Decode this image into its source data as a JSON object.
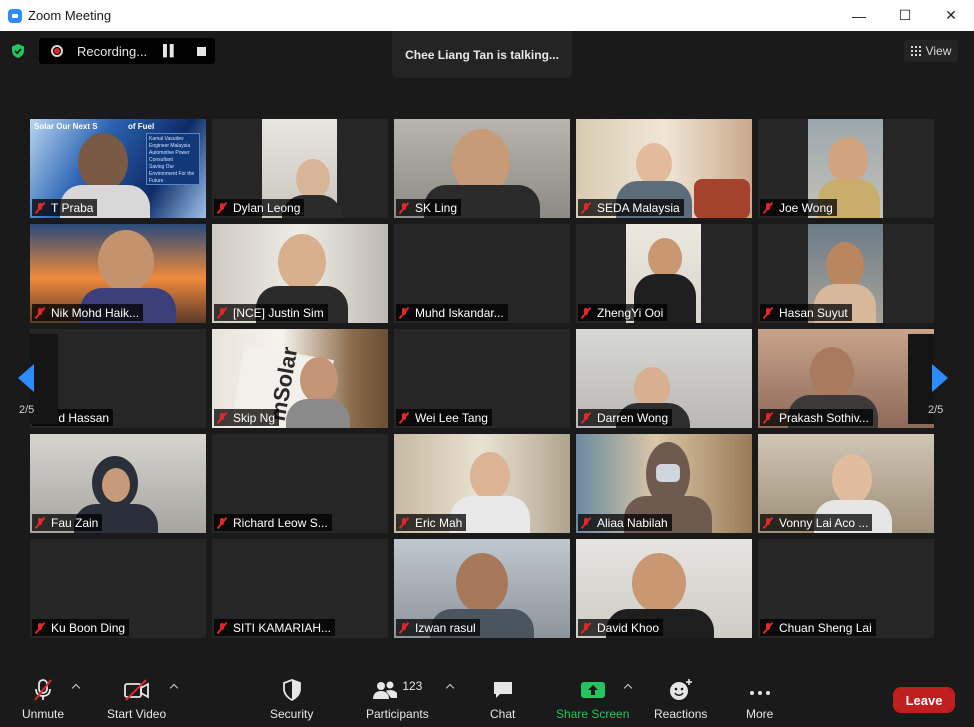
{
  "window": {
    "title": "Zoom Meeting"
  },
  "window_controls": [
    "—",
    "☐",
    "✕"
  ],
  "recording": {
    "label": "Recording...",
    "status": "recording"
  },
  "speaker_banner": "Chee Liang Tan is talking...",
  "view_button": "View",
  "gallery": {
    "page_indicator": "2/5",
    "participants": [
      {
        "name": "T Praba",
        "muted": true,
        "video": true
      },
      {
        "name": "Dylan Leong",
        "muted": true,
        "video": true
      },
      {
        "name": "SK Ling",
        "muted": true,
        "video": true
      },
      {
        "name": "SEDA Malaysia",
        "muted": true,
        "video": true
      },
      {
        "name": "Joe Wong",
        "muted": true,
        "video": true
      },
      {
        "name": "Nik Mohd Haik...",
        "muted": true,
        "video": true
      },
      {
        "name": "[NCE] Justin Sim",
        "muted": true,
        "video": true
      },
      {
        "name": "Muhd Iskandar...",
        "muted": true,
        "video": false
      },
      {
        "name": "ZhengYi Ooi",
        "muted": true,
        "video": true
      },
      {
        "name": "Hasan Suyut",
        "muted": true,
        "video": true
      },
      {
        "name": "Mohd Hassan",
        "muted": false,
        "video": false
      },
      {
        "name": "Skip Ng",
        "muted": true,
        "video": true
      },
      {
        "name": "Wei Lee Tang",
        "muted": true,
        "video": false
      },
      {
        "name": "Darren Wong",
        "muted": true,
        "video": true
      },
      {
        "name": "Prakash Sothiv...",
        "muted": true,
        "video": true
      },
      {
        "name": "Fau Zain",
        "muted": true,
        "video": true
      },
      {
        "name": "Richard Leow S...",
        "muted": true,
        "video": false
      },
      {
        "name": "Eric Mah",
        "muted": true,
        "video": true
      },
      {
        "name": "Aliaa Nabilah",
        "muted": true,
        "video": true
      },
      {
        "name": "Vonny Lai Aco ...",
        "muted": true,
        "video": true
      },
      {
        "name": "Ku Boon Ding",
        "muted": true,
        "video": false
      },
      {
        "name": "SITI KAMARIAH...",
        "muted": true,
        "video": false
      },
      {
        "name": "Izwan rasul",
        "muted": true,
        "video": true
      },
      {
        "name": "David Khoo",
        "muted": true,
        "video": true
      },
      {
        "name": "Chuan Sheng Lai",
        "muted": true,
        "video": false
      }
    ],
    "slide_text": {
      "line1": "Solar Our Next S",
      "line2": "of Fuel",
      "box1": "Kamal Vasudev",
      "box2": "Engineer Malaysia",
      "box3": "Automotive Power Consultant",
      "box4": "Saving Our Environment For the Future"
    },
    "banner_text": "mSolar"
  },
  "toolbar": {
    "unmute": "Unmute",
    "start_video": "Start Video",
    "security": "Security",
    "participants": "Participants",
    "participants_count": "123",
    "chat": "Chat",
    "share_screen": "Share Screen",
    "reactions": "Reactions",
    "more": "More",
    "leave": "Leave"
  },
  "colors": {
    "accent": "#2d8cff",
    "leave": "#c11f1f",
    "share": "#22c55e",
    "muted_mic": "#e02828"
  }
}
